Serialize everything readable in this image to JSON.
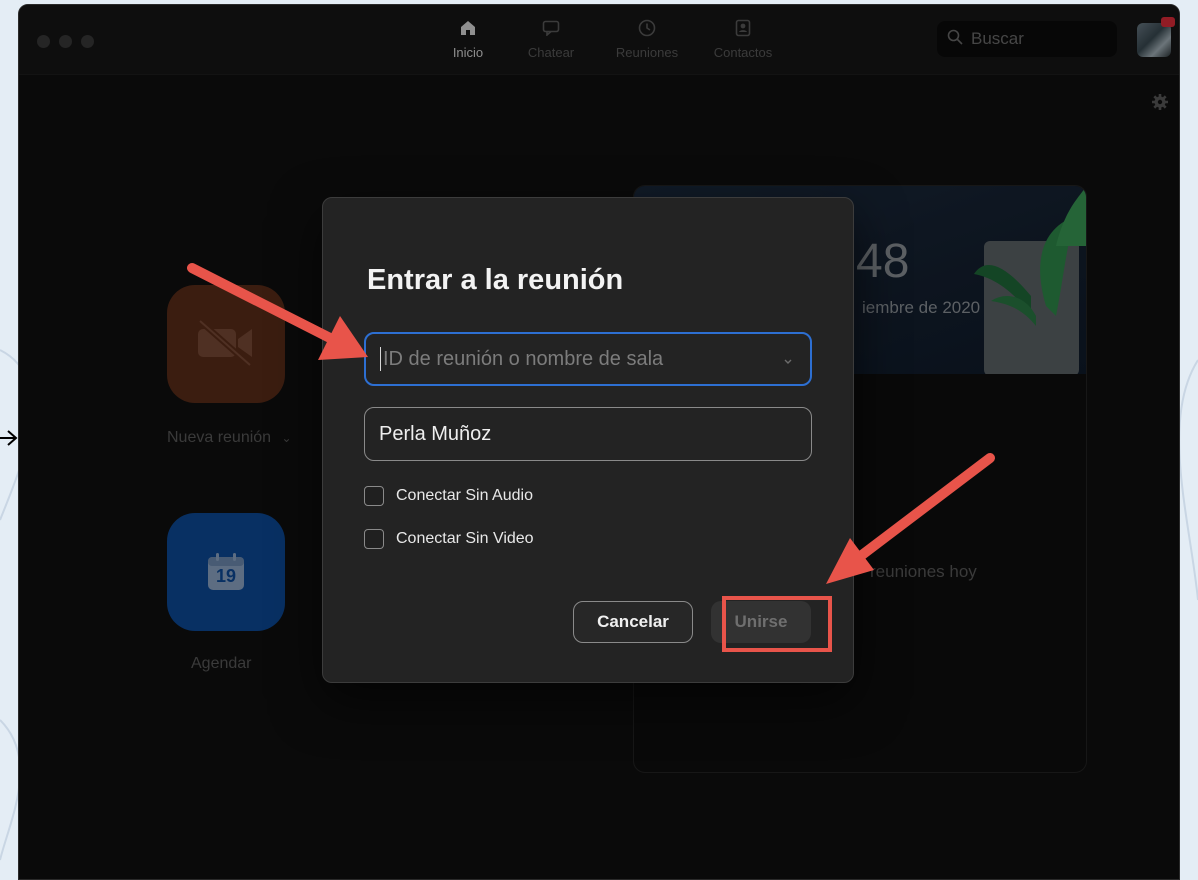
{
  "nav": {
    "tabs": [
      {
        "label": "Inicio",
        "icon": "home-icon",
        "active": true
      },
      {
        "label": "Chatear",
        "icon": "chat-icon",
        "active": false
      },
      {
        "label": "Reuniones",
        "icon": "clock-icon",
        "active": false
      },
      {
        "label": "Contactos",
        "icon": "contacts-icon",
        "active": false
      }
    ],
    "search_placeholder": "Buscar"
  },
  "home": {
    "new_meeting_label": "Nueva reunión",
    "schedule_label": "Agendar",
    "calendar_day": "19"
  },
  "card": {
    "clock": "48",
    "date": "iembre de 2020",
    "empty_text": "reuniones hoy"
  },
  "dialog": {
    "title": "Entrar a la reunión",
    "meeting_id_placeholder": "ID de reunión o nombre de sala",
    "name_value": "Perla Muñoz",
    "option_no_audio": "Conectar Sin Audio",
    "option_no_video": "Conectar Sin Video",
    "cancel_label": "Cancelar",
    "join_label": "Unirse"
  },
  "colors": {
    "accent_blue": "#2d6fd2",
    "annotation_red": "#e8544a",
    "new_meeting_orange": "#5b2d1a",
    "schedule_blue": "#0d4a98"
  }
}
